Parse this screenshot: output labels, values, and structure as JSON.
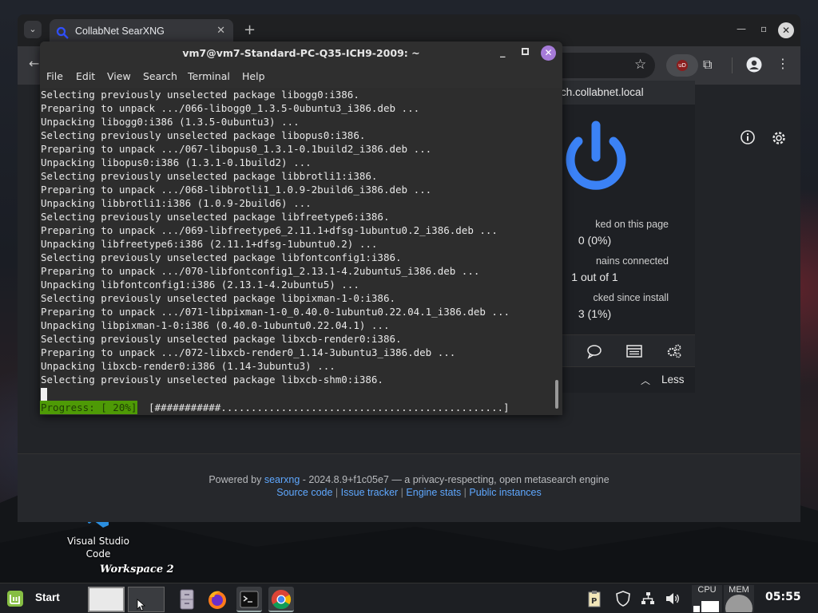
{
  "desktop": {
    "icons": [
      {
        "label": "Visual Studio Code"
      }
    ],
    "workspace_label": "Workspace 2"
  },
  "browser": {
    "tab": {
      "title": "CollabNet SearXNG"
    },
    "footer": {
      "powered_by": "Powered by",
      "engine_link": "searxng",
      "version_text": " - 2024.8.9+f1c05e7 — a privacy-respecting, open metasearch engine",
      "links": [
        "Source code",
        "Issue tracker",
        "Engine stats",
        "Public instances"
      ],
      "separator": " | "
    }
  },
  "ublock_popup": {
    "hostname": "ch.collabnet.local",
    "stats": [
      {
        "label": "ked on this page",
        "value": "0 (0%)"
      },
      {
        "label": "nains connected",
        "value": "1 out of 1"
      },
      {
        "label": "cked since install",
        "value": "3 (1%)"
      }
    ],
    "less_label": "Less"
  },
  "terminal": {
    "title": "vm7@vm7-Standard-PC-Q35-ICH9-2009: ~",
    "menu": [
      "File",
      "Edit",
      "View",
      "Search",
      "Terminal",
      "Help"
    ],
    "lines": [
      "Selecting previously unselected package libogg0:i386.",
      "Preparing to unpack .../066-libogg0_1.3.5-0ubuntu3_i386.deb ...",
      "Unpacking libogg0:i386 (1.3.5-0ubuntu3) ...",
      "Selecting previously unselected package libopus0:i386.",
      "Preparing to unpack .../067-libopus0_1.3.1-0.1build2_i386.deb ...",
      "Unpacking libopus0:i386 (1.3.1-0.1build2) ...",
      "Selecting previously unselected package libbrotli1:i386.",
      "Preparing to unpack .../068-libbrotli1_1.0.9-2build6_i386.deb ...",
      "Unpacking libbrotli1:i386 (1.0.9-2build6) ...",
      "Selecting previously unselected package libfreetype6:i386.",
      "Preparing to unpack .../069-libfreetype6_2.11.1+dfsg-1ubuntu0.2_i386.deb ...",
      "Unpacking libfreetype6:i386 (2.11.1+dfsg-1ubuntu0.2) ...",
      "Selecting previously unselected package libfontconfig1:i386.",
      "Preparing to unpack .../070-libfontconfig1_2.13.1-4.2ubuntu5_i386.deb ...",
      "Unpacking libfontconfig1:i386 (2.13.1-4.2ubuntu5) ...",
      "Selecting previously unselected package libpixman-1-0:i386.",
      "Preparing to unpack .../071-libpixman-1-0_0.40.0-1ubuntu0.22.04.1_i386.deb ...",
      "Unpacking libpixman-1-0:i386 (0.40.0-1ubuntu0.22.04.1) ...",
      "Selecting previously unselected package libxcb-render0:i386.",
      "Preparing to unpack .../072-libxcb-render0_1.14-3ubuntu3_i386.deb ...",
      "Unpacking libxcb-render0:i386 (1.14-3ubuntu3) ...",
      "Selecting previously unselected package libxcb-shm0:i386."
    ],
    "progress_label": "Progress: [ 20%]",
    "progress_bar": "[###########...............................................]",
    "progress_percent": 20
  },
  "taskbar": {
    "start_label": "Start",
    "cpu_label": "CPU",
    "mem_label": "MEM",
    "clock": "05:55"
  },
  "colors": {
    "progress_green": "#4e9a06",
    "link_blue": "#5fa8ff",
    "ubo_power_blue": "#3b82f6",
    "terminal_close_purple": "#a67bd8"
  }
}
